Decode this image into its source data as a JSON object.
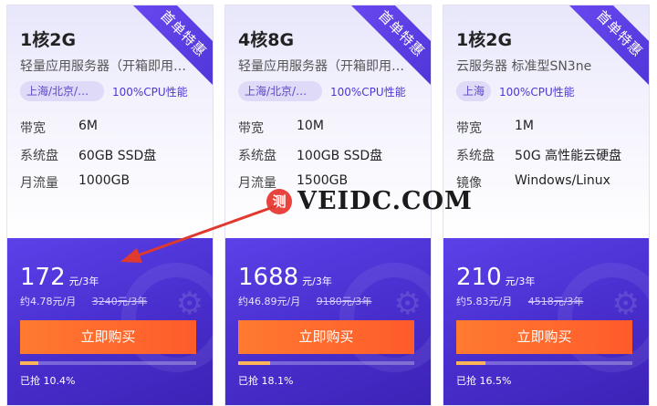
{
  "cards": [
    {
      "ribbon": "首单特惠",
      "title": "1核2G",
      "subtitle": "轻量应用服务器（开箱即用…",
      "region": "上海/北京/成都…",
      "cpu": "100%CPU性能",
      "specs": [
        {
          "k": "带宽",
          "v": "6M"
        },
        {
          "k": "系统盘",
          "v": "60GB SSD盘"
        },
        {
          "k": "月流量",
          "v": "1000GB"
        }
      ],
      "price": "172",
      "unit": "元/3年",
      "monthly": "约4.78元/月",
      "orig": "3240元/3年",
      "buy": "立即购买",
      "sold": "已抢 10.4%",
      "sold_fraction": 0.104
    },
    {
      "ribbon": "首单特惠",
      "title": "4核8G",
      "subtitle": "轻量应用服务器（开箱即用…",
      "region": "上海/北京/成都…",
      "cpu": "100%CPU性能",
      "specs": [
        {
          "k": "带宽",
          "v": "10M"
        },
        {
          "k": "系统盘",
          "v": "100GB SSD盘"
        },
        {
          "k": "月流量",
          "v": "1500GB"
        }
      ],
      "price": "1688",
      "unit": "元/3年",
      "monthly": "约46.89元/月",
      "orig": "9180元/3年",
      "buy": "立即购买",
      "sold": "已抢 18.1%",
      "sold_fraction": 0.181
    },
    {
      "ribbon": "首单特惠",
      "title": "1核2G",
      "subtitle": "云服务器 标准型SN3ne",
      "region": "上海",
      "cpu": "100%CPU性能",
      "specs": [
        {
          "k": "带宽",
          "v": "1M"
        },
        {
          "k": "系统盘",
          "v": "50G 高性能云硬盘"
        },
        {
          "k": "镜像",
          "v": "Windows/Linux"
        }
      ],
      "price": "210",
      "unit": "元/3年",
      "monthly": "约5.83元/月",
      "orig": "4518元/3年",
      "buy": "立即购买",
      "sold": "已抢 16.5%",
      "sold_fraction": 0.165
    }
  ],
  "watermark": {
    "logo": "测",
    "text": "VEIDC.COM"
  },
  "colors": {
    "accent": "#4b37d4",
    "button": "#ff6a2e",
    "arrow": "#e03a2f"
  }
}
